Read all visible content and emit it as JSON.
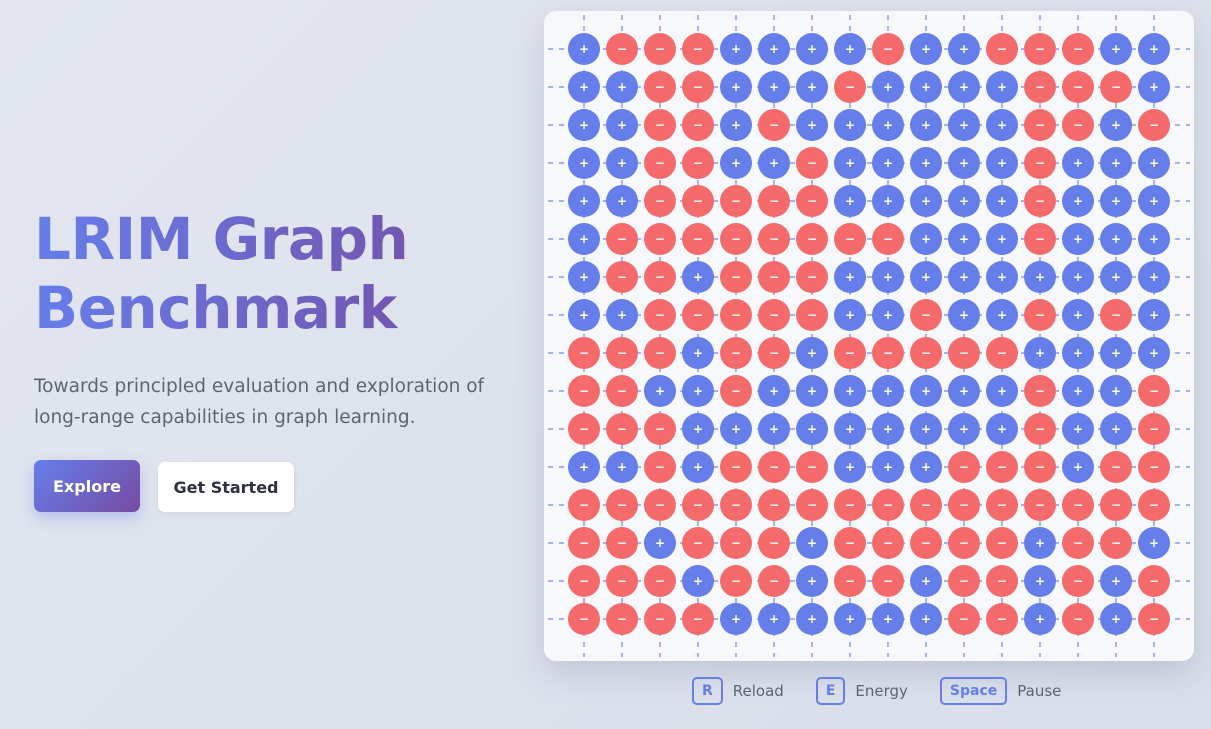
{
  "hero": {
    "title_line1": "LRIM Graph",
    "title_line2": "Benchmark",
    "subtitle": "Towards principled evaluation and exploration of long-range capabilities in graph learning."
  },
  "actions": {
    "explore_label": "Explore",
    "get_started_label": "Get Started"
  },
  "colors": {
    "plus": "#667eea",
    "minus": "#f56b6b",
    "edge": "#6f86e8",
    "accent": "#667eea"
  },
  "lattice": {
    "plus_symbol": "+",
    "minus_symbol": "−",
    "spins": [
      "+---++++-++---++",
      "++--+++-++++---+",
      "++--+-++++++--+-",
      "++--++-+++++-+++",
      "++-----+++++-+++",
      "+--------+++-+++",
      "+--+---+++++++++",
      "++-----++-++-+-+",
      "---+--+-----++++",
      "--++-+++++++-++-",
      "---+++++++++-++-",
      "++-+---+++---+--",
      "----------------",
      "--+---+-----+--+",
      "---+--+--+--+-+-",
      "----++++++--+-+-"
    ]
  },
  "legend": [
    {
      "key": "R",
      "label": "Reload"
    },
    {
      "key": "E",
      "label": "Energy"
    },
    {
      "key": "Space",
      "label": "Pause"
    }
  ]
}
